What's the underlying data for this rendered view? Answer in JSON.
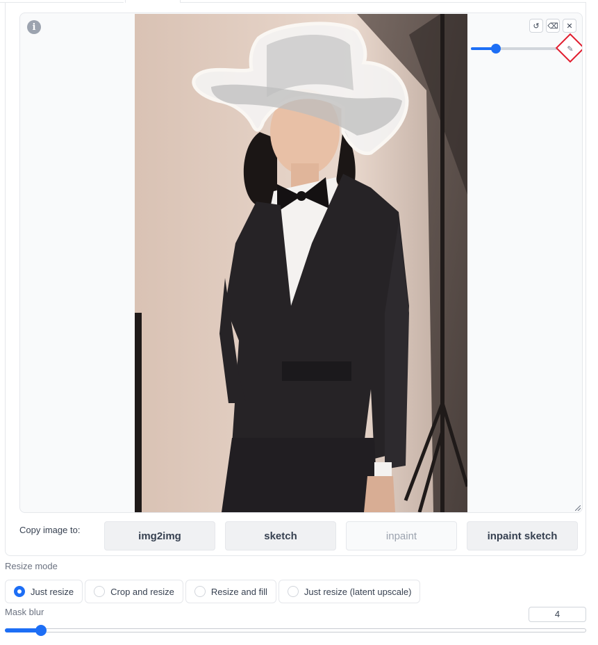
{
  "editor": {
    "info_icon": "info-icon",
    "tool_buttons": [
      {
        "icon": "undo-icon",
        "glyph": "↺"
      },
      {
        "icon": "eraser-icon",
        "glyph": "⌫"
      },
      {
        "icon": "close-icon",
        "glyph": "✕"
      }
    ],
    "brush_size_fraction": 0.28,
    "color_picker_icon": "brush-icon"
  },
  "copy": {
    "label": "Copy image to:",
    "buttons": [
      {
        "label": "img2img",
        "enabled": true
      },
      {
        "label": "sketch",
        "enabled": true
      },
      {
        "label": "inpaint",
        "enabled": false
      },
      {
        "label": "inpaint sketch",
        "enabled": true
      }
    ]
  },
  "resize": {
    "label": "Resize mode",
    "options": [
      "Just resize",
      "Crop and resize",
      "Resize and fill",
      "Just resize (latent upscale)"
    ],
    "selected": "Just resize"
  },
  "mask_blur": {
    "label": "Mask blur",
    "value": "4",
    "min": 0,
    "max": 64
  },
  "colors": {
    "accent": "#1d6ef5",
    "highlight": "#e11d2e"
  }
}
